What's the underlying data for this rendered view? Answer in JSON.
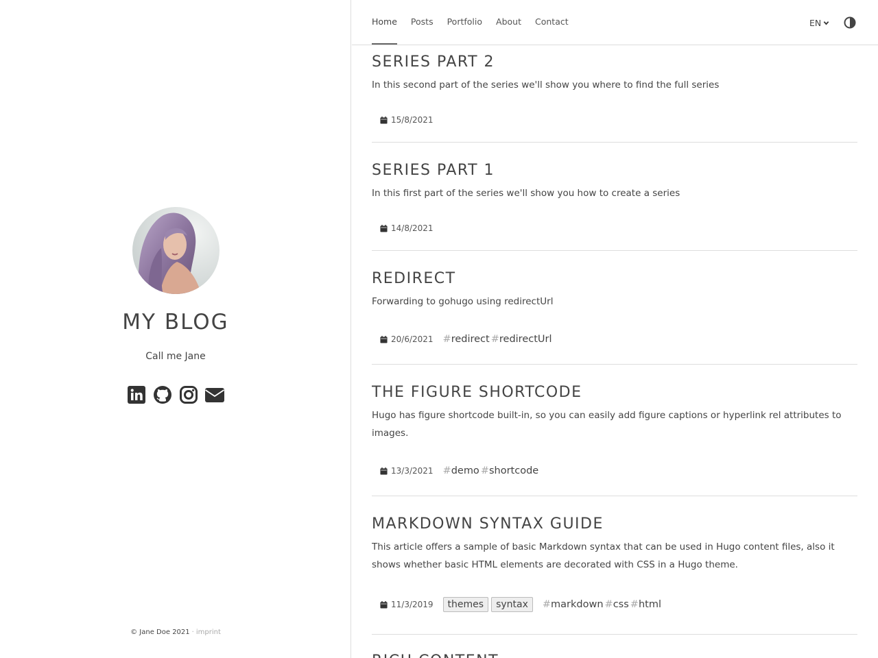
{
  "sidebar": {
    "title": "MY BLOG",
    "tagline": "Call me Jane",
    "socials": [
      "linkedin-icon",
      "github-icon",
      "instagram-icon",
      "envelope-icon"
    ],
    "footer": {
      "copyright": "© Jane Doe 2021",
      "separator": "·",
      "imprint": "imprint"
    }
  },
  "nav": {
    "items": [
      "Home",
      "Posts",
      "Portfolio",
      "About",
      "Contact"
    ],
    "active": "Home",
    "language": "EN"
  },
  "posts": [
    {
      "title": "SERIES PART 2",
      "summary": "In this second part of the series we'll show you where to find the full series",
      "date": "15/8/2021",
      "categories": [],
      "tags": []
    },
    {
      "title": "SERIES PART 1",
      "summary": "In this first part of the series we'll show you how to create a series",
      "date": "14/8/2021",
      "categories": [],
      "tags": []
    },
    {
      "title": "REDIRECT",
      "summary": "Forwarding to gohugo using redirectUrl",
      "date": "20/6/2021",
      "categories": [],
      "tags": [
        "redirect",
        "redirectUrl"
      ]
    },
    {
      "title": "THE FIGURE SHORTCODE",
      "summary": "Hugo has figure shortcode built-in, so you can easily add figure captions or hyperlink rel attributes to images.",
      "date": "13/3/2021",
      "categories": [],
      "tags": [
        "demo",
        "shortcode"
      ]
    },
    {
      "title": "MARKDOWN SYNTAX GUIDE",
      "summary": "This article offers a sample of basic Markdown syntax that can be used in Hugo content files, also it shows whether basic HTML elements are decorated with CSS in a Hugo theme.",
      "date": "11/3/2019",
      "categories": [
        "themes",
        "syntax"
      ],
      "tags": [
        "markdown",
        "css",
        "html"
      ]
    },
    {
      "title": "RICH CONTENT",
      "summary": "",
      "date": "",
      "categories": [],
      "tags": []
    }
  ]
}
